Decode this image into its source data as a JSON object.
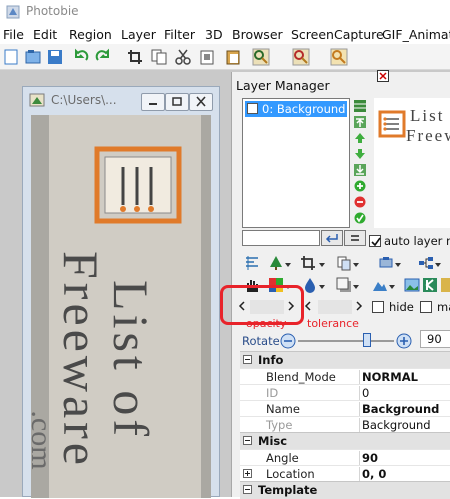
{
  "app": {
    "title": "Photobie"
  },
  "menu": [
    "File",
    "Edit",
    "Region",
    "Layer",
    "Filter",
    "3D",
    "Browser",
    "ScreenCapture",
    "GIF_Animatio"
  ],
  "document": {
    "title": "C:\\Users\\...",
    "image_text": {
      "line1": "List of",
      "line2": "Freeware",
      "line3": ".com"
    }
  },
  "layer_manager": {
    "title": "Layer Manager",
    "layers": [
      "0: Background"
    ],
    "auto_layer_label": "auto layer ma",
    "opacity_label": "opacity",
    "tolerance_label": "tolerance",
    "hide_label": "hide",
    "ma_label": "ma",
    "rotate_label": "Rotate",
    "rotate_value": "90",
    "preview_text": {
      "line1": "List o",
      "line2": "Freewa"
    }
  },
  "properties": {
    "sections": [
      {
        "name": "Info",
        "rows": [
          {
            "key": "Blend_Mode",
            "value": "NORMAL",
            "bold": true,
            "dim": false
          },
          {
            "key": "ID",
            "value": "0",
            "bold": false,
            "dim": true
          },
          {
            "key": "Name",
            "value": "Background",
            "bold": true,
            "dim": false
          },
          {
            "key": "Type",
            "value": "Background",
            "bold": false,
            "dim": true
          }
        ]
      },
      {
        "name": "Misc",
        "rows": [
          {
            "key": "Angle",
            "value": "90",
            "bold": true,
            "dim": false
          },
          {
            "key": "Location",
            "value": "0, 0",
            "bold": true,
            "dim": false,
            "expand": true
          }
        ]
      },
      {
        "name": "Template",
        "rows": []
      }
    ]
  },
  "colors": {
    "accent_blue": "#3399ff",
    "annotation_red": "#e8232a",
    "logo_orange": "#e07a2a"
  }
}
